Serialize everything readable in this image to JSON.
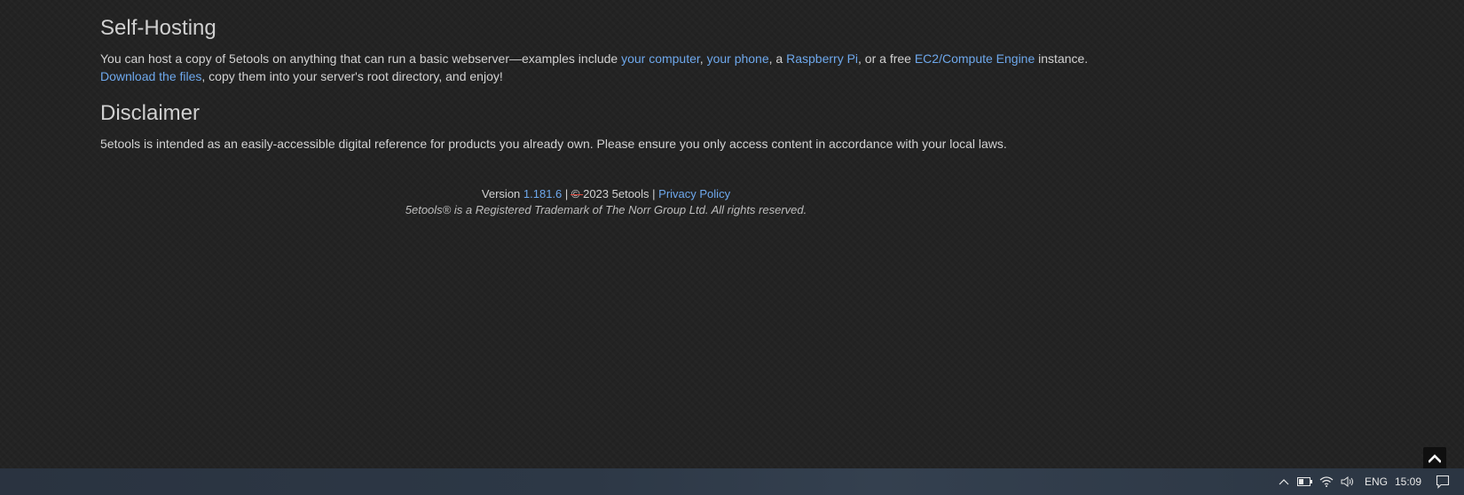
{
  "sections": {
    "self_hosting": {
      "heading": "Self-Hosting",
      "text_1": "You can host a copy of 5etools on anything that can run a basic webserver—examples include ",
      "link_computer": "your computer",
      "sep_1": ", ",
      "link_phone": "your phone",
      "sep_2": ", a ",
      "link_raspberry": "Raspberry Pi",
      "sep_3": ", or a free ",
      "link_ec2": "EC2/Compute Engine",
      "text_2": " instance.",
      "link_download": "Download the files",
      "text_3": ", copy them into your server's root directory, and enjoy!"
    },
    "disclaimer": {
      "heading": "Disclaimer",
      "text": "5etools is intended as an easily-accessible digital reference for products you already own. Please ensure you only access content in accordance with your local laws."
    }
  },
  "footer": {
    "version_label": "Version ",
    "version_number": "1.181.6",
    "sep_a": " | ",
    "copyright_symbol": "©",
    "copyright_text": " 2023 5etools | ",
    "privacy_link": "Privacy Policy",
    "trademark": "5etools® is a Registered Trademark of The Norr Group Ltd. All rights reserved."
  },
  "scroll_top": {
    "icon": "chevron-up-icon"
  },
  "taskbar": {
    "language": "ENG",
    "time": "15:09",
    "icons": [
      "chevron-up-icon",
      "battery-icon",
      "wifi-icon",
      "volume-icon",
      "notification-icon"
    ]
  },
  "colors": {
    "background": "#232323",
    "link": "#6ea8ec",
    "text": "#d2d2d2",
    "taskbar": "#2d3846"
  }
}
